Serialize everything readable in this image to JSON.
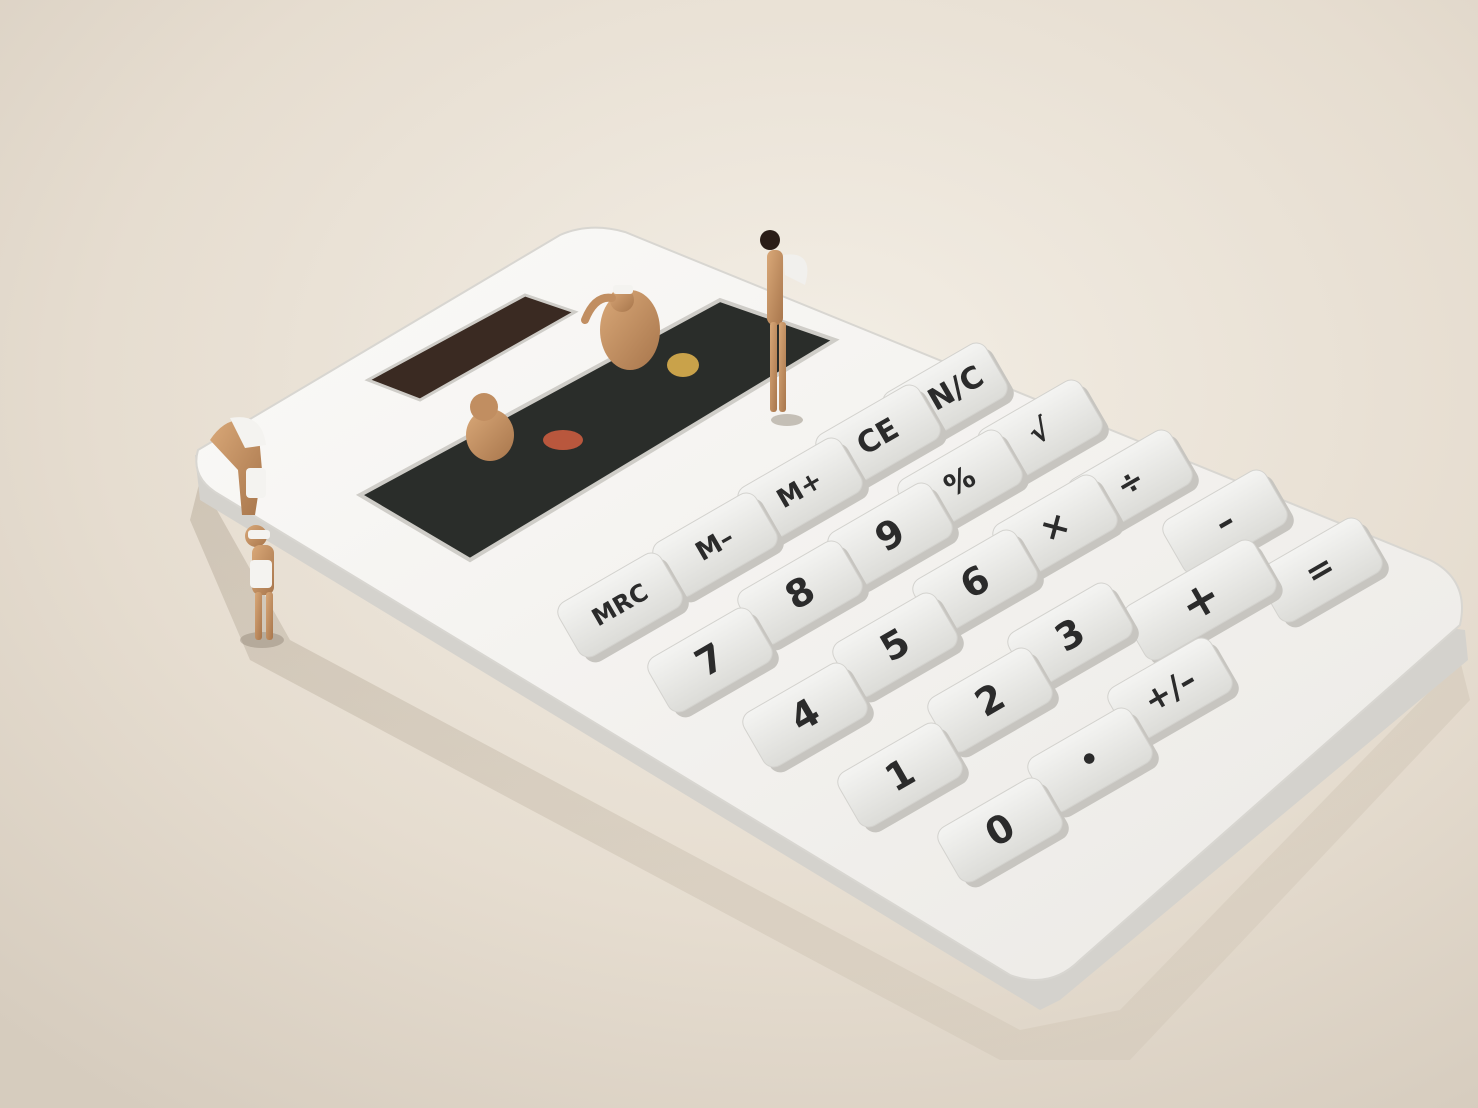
{
  "photo": {
    "subject": "white calculator with miniature bather figurines",
    "colors": {
      "background": "#e8e0d4",
      "calculator_body": "#f2f1ee",
      "key_face": "#ececea",
      "display_window": "#2a2d2a",
      "skin": "#c9966a"
    }
  },
  "calculator": {
    "keys": {
      "on_c": "ON/C",
      "ce": "CE",
      "sqrt": "√",
      "m_plus": "M+",
      "percent": "%",
      "divide": "÷",
      "m_minus": "M–",
      "nine": "9",
      "multiply": "×",
      "minus": "–",
      "equals": "=",
      "mrc": "MRC",
      "eight": "8",
      "six": "6",
      "plus": "+",
      "seven": "7",
      "five": "5",
      "three": "3",
      "four": "4",
      "two": "2",
      "plus_minus": "+/–",
      "one": "1",
      "dot": "•",
      "zero": "0"
    }
  }
}
